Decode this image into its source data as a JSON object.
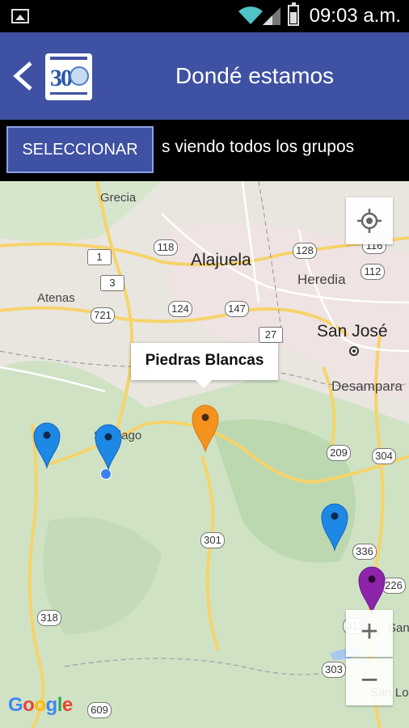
{
  "status_bar": {
    "time": "09:03 a.m."
  },
  "app_bar": {
    "title": "Dondé estamos",
    "logo_text": "30"
  },
  "selector": {
    "button_label": "SELECCIONAR",
    "status_text": "s viendo todos los grupos"
  },
  "map": {
    "places": [
      "Grecia",
      "Alajuela",
      "Heredia",
      "Atenas",
      "San José",
      "Desampara",
      "Santiago",
      "San",
      "San Lo"
    ],
    "route_shields": [
      "118",
      "116",
      "128",
      "112",
      "1",
      "3",
      "721",
      "124",
      "147",
      "27",
      "209",
      "304",
      "301",
      "336",
      "226",
      "318",
      "313",
      "303",
      "609"
    ],
    "info_window": "Piedras Blancas",
    "markers": [
      {
        "color": "#1e88e5"
      },
      {
        "color": "#1e88e5"
      },
      {
        "color": "#f4921e"
      },
      {
        "color": "#1e88e5"
      },
      {
        "color": "#8e24aa"
      }
    ],
    "attribution": "Google",
    "zoom_in": "+",
    "zoom_out": "−"
  },
  "colors": {
    "app_bar": "#3f51a3",
    "map_bg": "#e9e6df"
  }
}
